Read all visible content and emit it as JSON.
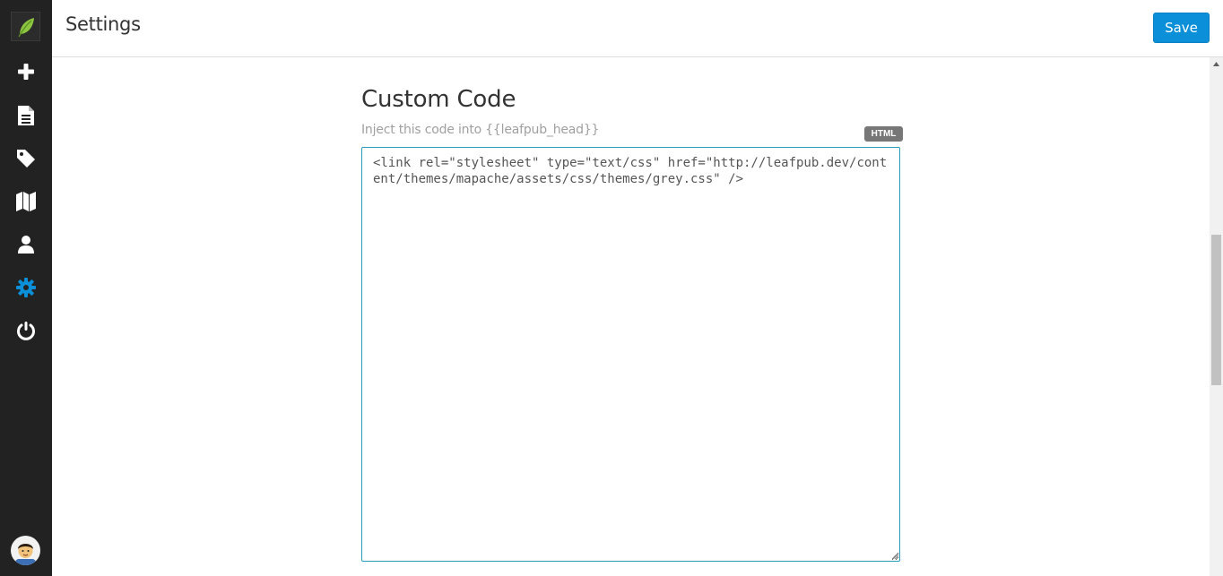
{
  "header": {
    "title": "Settings",
    "save_label": "Save"
  },
  "sidebar": {
    "logo_icon": "leaf-icon",
    "items": [
      {
        "icon": "plus-icon",
        "active": false
      },
      {
        "icon": "document-icon",
        "active": false
      },
      {
        "icon": "tag-icon",
        "active": false
      },
      {
        "icon": "map-icon",
        "active": false
      },
      {
        "icon": "user-icon",
        "active": false
      },
      {
        "icon": "gear-icon",
        "active": true
      },
      {
        "icon": "power-icon",
        "active": false
      }
    ],
    "avatar_icon": "user-avatar"
  },
  "custom_code": {
    "title": "Custom Code",
    "hint": "Inject this code into {{leafpub_head}}",
    "badge": "HTML",
    "value": "<link rel=\"stylesheet\" type=\"text/css\" href=\"http://leafpub.dev/content/themes/mapache/assets/css/themes/grey.css\" />"
  },
  "colors": {
    "sidebar_bg": "#222222",
    "active_icon": "#0a8fd8",
    "icon": "#ffffff",
    "primary": "#0a8fd8",
    "textarea_border": "#2a9bb8",
    "badge_bg": "#777777"
  }
}
